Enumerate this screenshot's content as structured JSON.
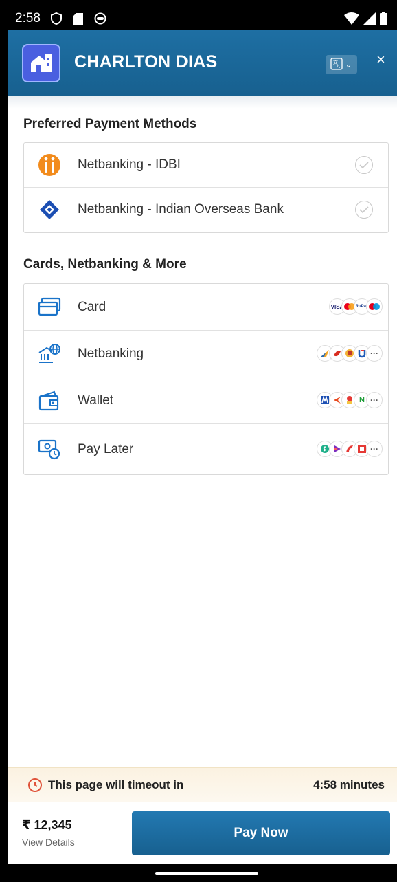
{
  "status_bar": {
    "time": "2:58",
    "icons": [
      "shield-icon",
      "sd-card-icon",
      "smiley-icon",
      "wifi-icon",
      "signal-icon",
      "battery-icon"
    ]
  },
  "header": {
    "brand_name": "CHARLTON DIAS",
    "language_icon": "translate-icon",
    "close_label": "×",
    "accent_color": "#17608f"
  },
  "preferred": {
    "title": "Preferred Payment Methods",
    "items": [
      {
        "label": "Netbanking - IDBI",
        "icon": "idbi-bank-icon"
      },
      {
        "label": "Netbanking - Indian Overseas Bank",
        "icon": "iob-bank-icon"
      }
    ]
  },
  "more": {
    "title": "Cards, Netbanking & More",
    "items": [
      {
        "label": "Card",
        "icon": "card-icon",
        "logos": [
          "VISA",
          "MC",
          "RuPay",
          "Maestro"
        ]
      },
      {
        "label": "Netbanking",
        "icon": "bank-globe-icon",
        "logos": [
          "bank-1",
          "bank-2",
          "bank-3",
          "bank-4"
        ],
        "more": "···"
      },
      {
        "label": "Wallet",
        "icon": "wallet-icon",
        "logos": [
          "wallet-1",
          "wallet-2",
          "wallet-3",
          "wallet-4"
        ],
        "more": "···"
      },
      {
        "label": "Pay Later",
        "icon": "pay-later-icon",
        "logos": [
          "paylater-1",
          "paylater-2",
          "paylater-3",
          "paylater-4"
        ],
        "more": "···"
      }
    ]
  },
  "timeout": {
    "message": "This page will timeout in",
    "countdown": "4:58 minutes"
  },
  "footer": {
    "amount": "₹ 12,345",
    "view_details": "View Details",
    "pay_now": "Pay Now"
  }
}
